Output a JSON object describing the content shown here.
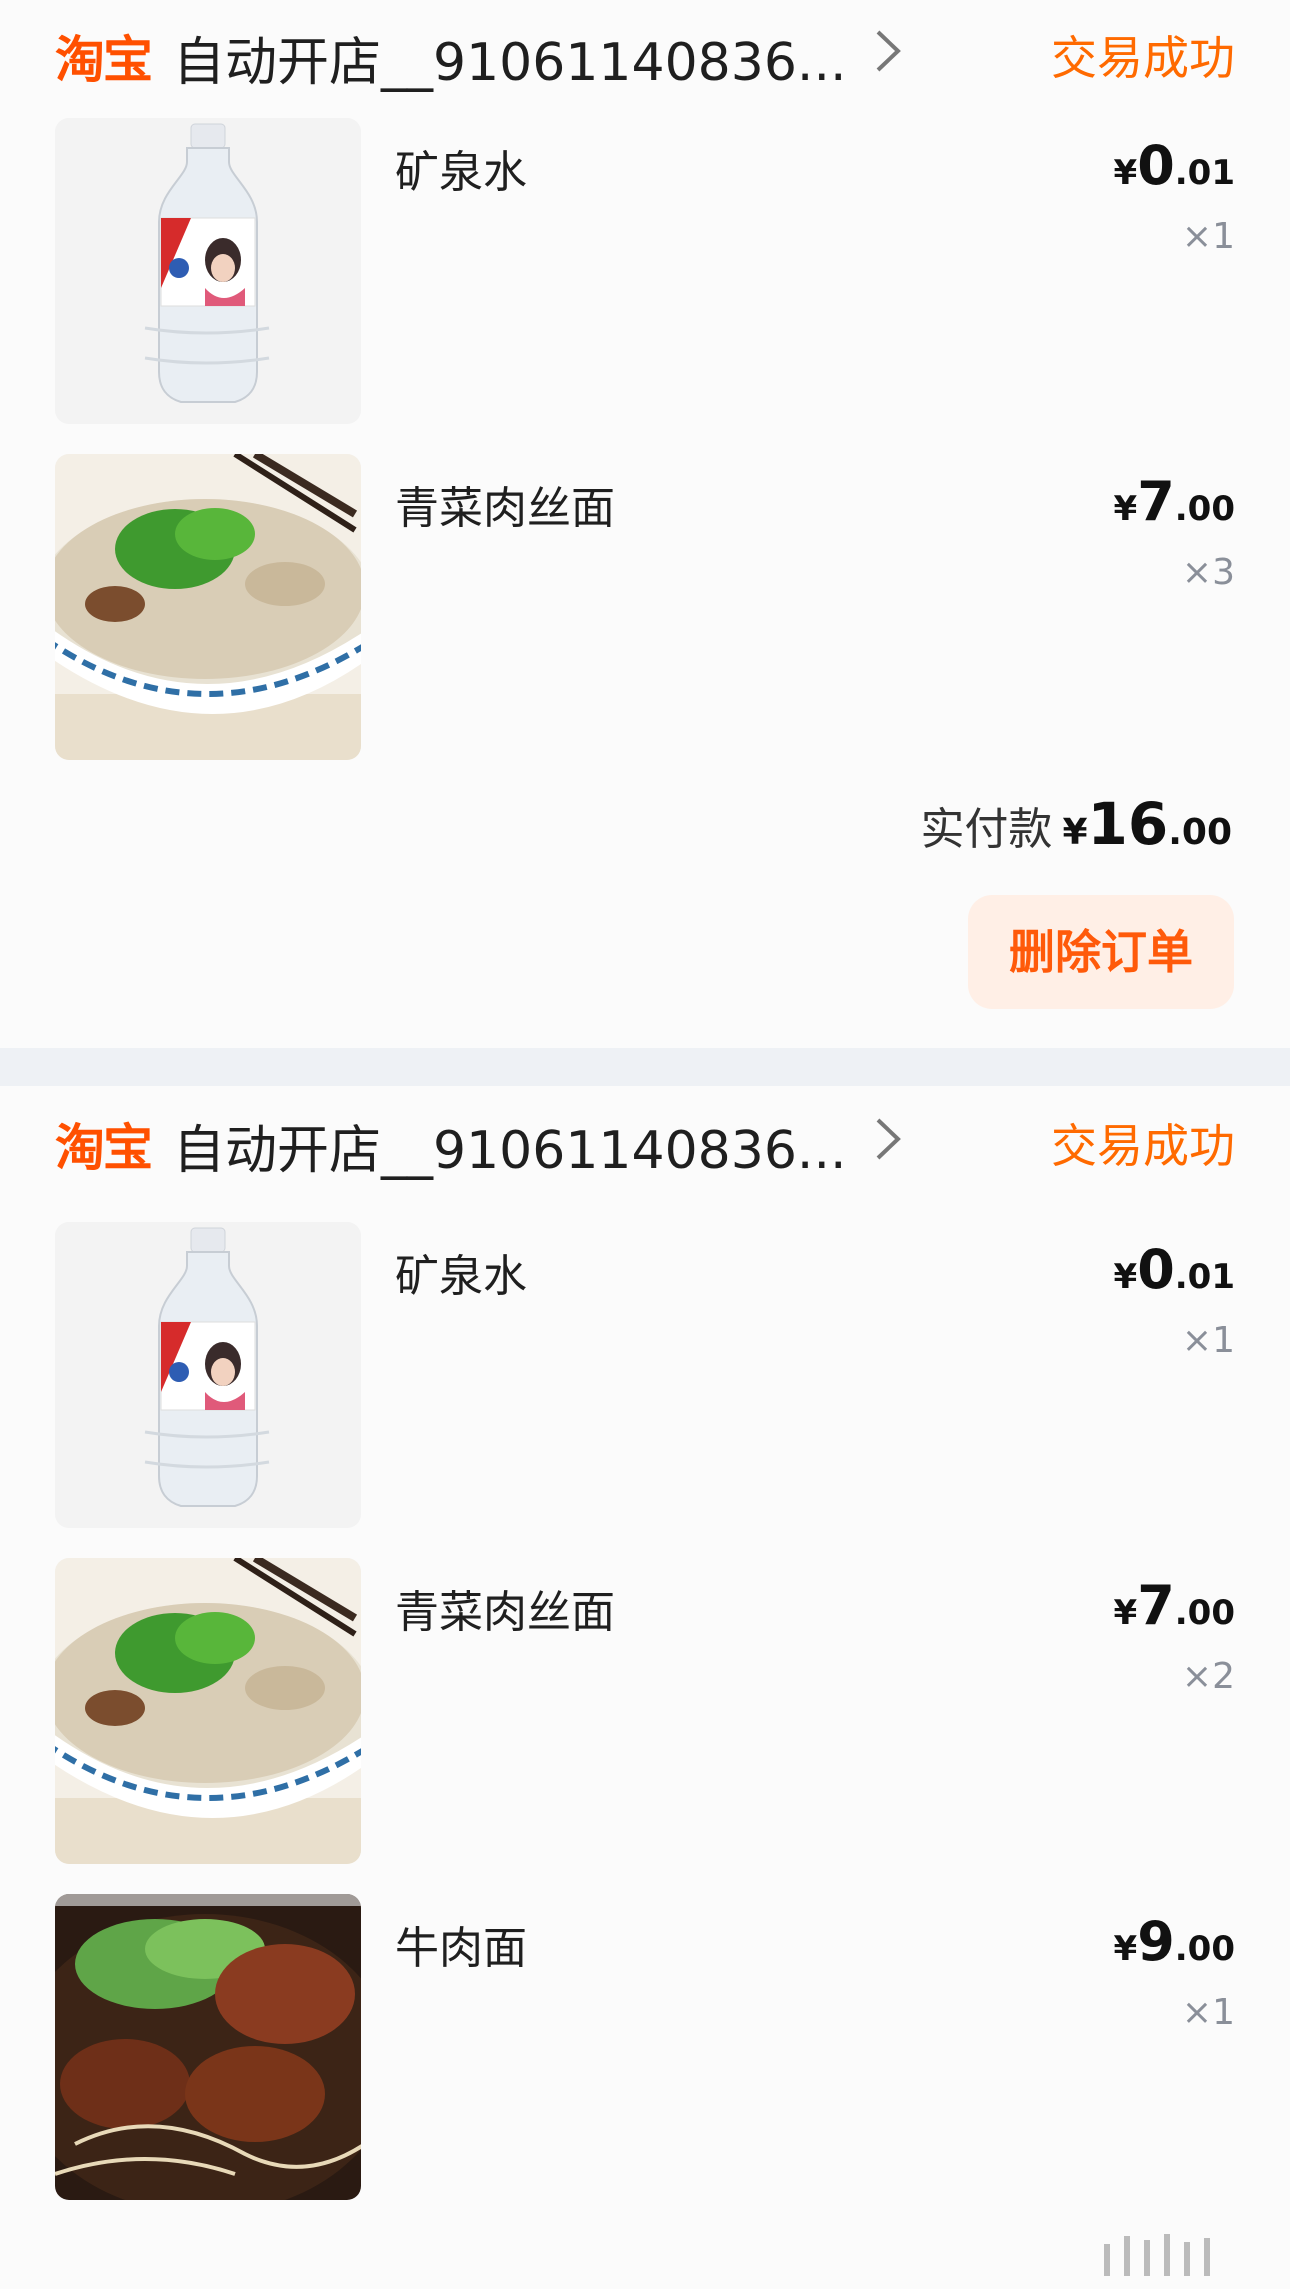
{
  "orders": [
    {
      "shop_logo": "淘宝",
      "shop_name": "自动开店__91061140836...",
      "status": "交易成功",
      "items": [
        {
          "title": "矿泉水",
          "price_symbol": "¥",
          "price_int": "0",
          "price_dec": ".01",
          "qty": "×1",
          "image": "water-bottle"
        },
        {
          "title": "青菜肉丝面",
          "price_symbol": "¥",
          "price_int": "7",
          "price_dec": ".00",
          "qty": "×3",
          "image": "vegetable-pork-noodles"
        }
      ],
      "total_label": "实付款",
      "total_symbol": "¥",
      "total_int": "16",
      "total_dec": ".00",
      "delete_label": "删除订单"
    },
    {
      "shop_logo": "淘宝",
      "shop_name": "自动开店__91061140836...",
      "status": "交易成功",
      "items": [
        {
          "title": "矿泉水",
          "price_symbol": "¥",
          "price_int": "0",
          "price_dec": ".01",
          "qty": "×1",
          "image": "water-bottle"
        },
        {
          "title": "青菜肉丝面",
          "price_symbol": "¥",
          "price_int": "7",
          "price_dec": ".00",
          "qty": "×2",
          "image": "vegetable-pork-noodles"
        },
        {
          "title": "牛肉面",
          "price_symbol": "¥",
          "price_int": "9",
          "price_dec": ".00",
          "qty": "×1",
          "image": "beef-noodles"
        }
      ]
    }
  ],
  "colors": {
    "brand": "#ff5000",
    "status": "#ff6a00",
    "button_bg": "#ffefe6",
    "separator": "#eef1f5"
  },
  "icons": {
    "chevron": "chevron-right-icon"
  }
}
